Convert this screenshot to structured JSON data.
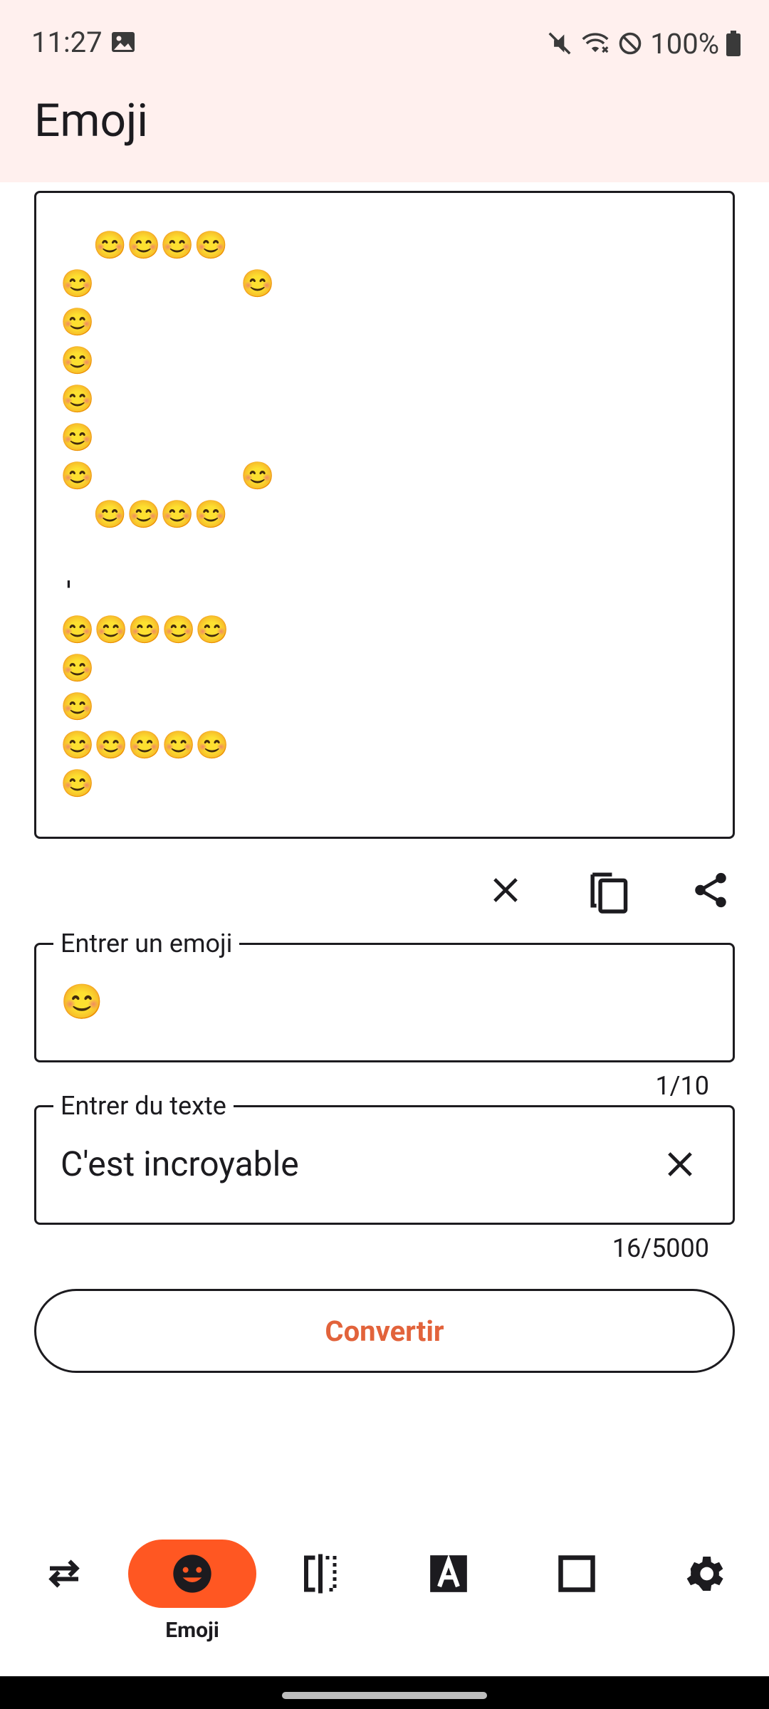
{
  "status_bar": {
    "time": "11:27",
    "battery": "100%"
  },
  "app_bar": {
    "title": "Emoji"
  },
  "output": {
    "lines": [
      "  😊😊😊😊",
      "😊         😊",
      "😊",
      "😊",
      "😊",
      "😊",
      "😊         😊",
      "  😊😊😊😊",
      "",
      "'",
      "😊😊😊😊😊",
      "😊",
      "😊",
      "😊😊😊😊😊",
      "😊"
    ]
  },
  "actions": {
    "clear_icon": "close-icon",
    "copy_icon": "copy-icon",
    "share_icon": "share-icon"
  },
  "emoji_field": {
    "label": "Entrer un emoji",
    "value": "😊",
    "counter": "1/10"
  },
  "text_field": {
    "label": "Entrer du texte",
    "value": "C'est incroyable",
    "counter": "16/5000"
  },
  "convert_button": {
    "label": "Convertir"
  },
  "bottom_nav": {
    "items": [
      {
        "icon": "swap-icon",
        "label": ""
      },
      {
        "icon": "emoji-icon",
        "label": "Emoji"
      },
      {
        "icon": "mirror-icon",
        "label": ""
      },
      {
        "icon": "font-icon",
        "label": ""
      },
      {
        "icon": "square-icon",
        "label": ""
      },
      {
        "icon": "gear-icon",
        "label": ""
      }
    ],
    "active_index": 1
  },
  "colors": {
    "accent": "#ff5722",
    "button_text": "#e2633b",
    "header_bg": "#fff0ee"
  }
}
